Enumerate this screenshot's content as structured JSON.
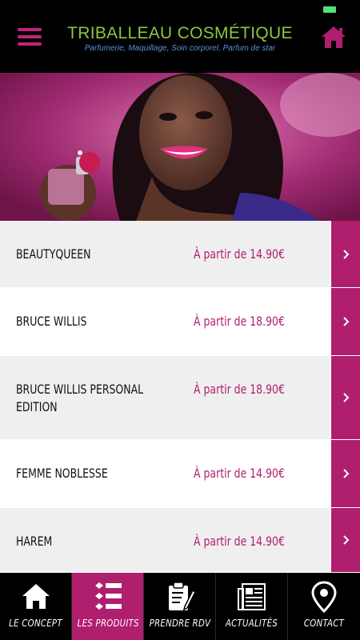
{
  "header": {
    "title": "TRIBALLEAU COSMÉTIQUE",
    "subtitle": "Parfumerie, Maquillage, Soin corporel, Parfum de star",
    "menu_icon": "hamburger-icon",
    "home_icon": "home-icon"
  },
  "colors": {
    "accent": "#b01f6e",
    "brand_title": "#8cc63f",
    "brand_subtitle": "#5b8fd8",
    "background": "#000000"
  },
  "products": [
    {
      "name": "BEAUTYQUEEN",
      "price": "À partir de 14.90€"
    },
    {
      "name": "BRUCE WILLIS",
      "price": "À partir de 18.90€"
    },
    {
      "name": "BRUCE WILLIS PERSONAL EDITION",
      "price": "À partir de 18.90€"
    },
    {
      "name": "FEMME NOBLESSE",
      "price": "À partir de 14.90€"
    },
    {
      "name": "HAREM",
      "price": "À partir de 14.90€"
    }
  ],
  "tabs": [
    {
      "label": "LE CONCEPT",
      "icon": "home-icon",
      "active": false
    },
    {
      "label": "LES PRODUITS",
      "icon": "list-icon",
      "active": true
    },
    {
      "label": "PRENDRE RDV",
      "icon": "clipboard-pen-icon",
      "active": false
    },
    {
      "label": "ACTUALITÉS",
      "icon": "newspaper-icon",
      "active": false
    },
    {
      "label": "CONTACT",
      "icon": "location-pin-icon",
      "active": false
    }
  ]
}
